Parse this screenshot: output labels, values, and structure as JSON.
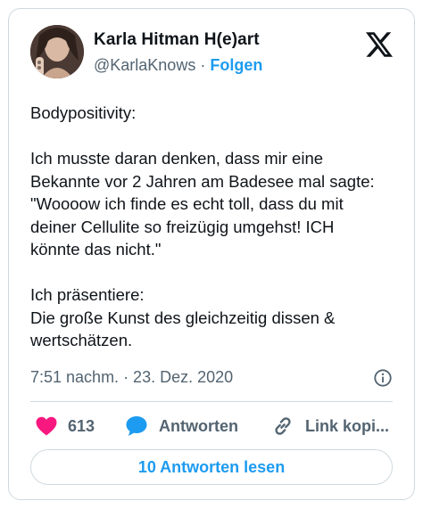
{
  "post": {
    "author_name": "Karla Hitman H(e)art",
    "handle": "@KarlaKnows",
    "separator": "·",
    "follow_label": "Folgen",
    "text_lines": {
      "l1": "Bodypositivity:",
      "l2": "Ich musste daran denken, dass mir eine",
      "l3": "Bekannte vor 2 Jahren am Badesee mal sagte:",
      "l4": "\"Woooow ich finde es echt toll, dass du mit",
      "l5": "deiner Cellulite so freizügig umgehst! ICH",
      "l6": "könnte das nicht.\"",
      "l7": "Ich präsentiere:",
      "l8": "Die große Kunst des gleichzeitig dissen &",
      "l9": "wertschätzen."
    },
    "timestamp": "7:51 nachm. · 23. Dez. 2020"
  },
  "actions": {
    "like_count": "613",
    "reply_label": "Antworten",
    "copy_label": "Link kopi..."
  },
  "footer": {
    "read_replies_label": "10 Antworten lesen"
  },
  "colors": {
    "accent": "#1d9bf0",
    "like": "#f91880",
    "text": "#0f1419",
    "muted": "#536471",
    "border": "#cfd9de"
  },
  "icons": {
    "brand": "x-logo-icon",
    "info": "info-icon",
    "like": "heart-icon",
    "reply": "speech-bubble-icon",
    "copy": "link-icon"
  }
}
